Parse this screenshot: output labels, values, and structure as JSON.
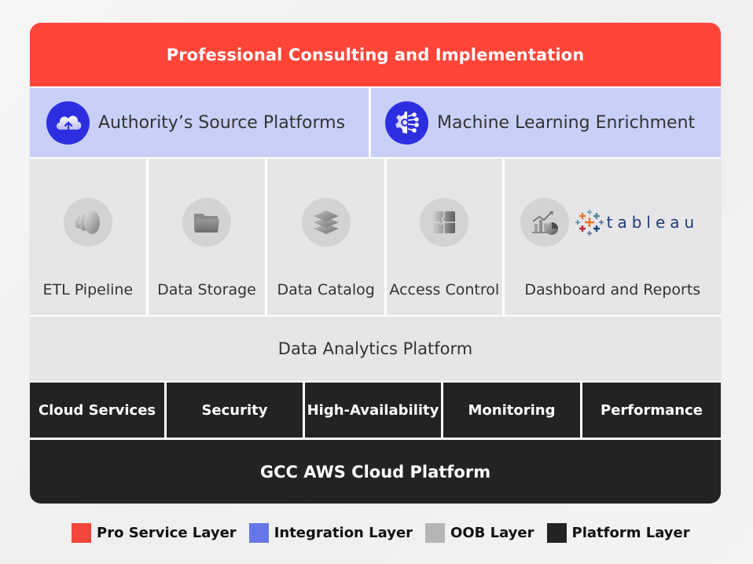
{
  "pro_service": {
    "title": "Professional Consulting and Implementation",
    "color": "#ff4438"
  },
  "integration": {
    "items": [
      {
        "label": "Authority’s Source Platforms",
        "icon": "cloud-upload-icon"
      },
      {
        "label": "Machine Learning Enrichment",
        "icon": "ai-gear-circuit-icon"
      }
    ],
    "color": "#c8d0f8",
    "icon_color": "#2c2ee0"
  },
  "oob": {
    "items": [
      {
        "label": "ETL Pipeline",
        "icon": "pipeline-icon"
      },
      {
        "label": "Data Storage",
        "icon": "folder-icon"
      },
      {
        "label": "Data Catalog",
        "icon": "layers-icon"
      },
      {
        "label": "Access Control",
        "icon": "puzzle-icon"
      },
      {
        "label": "Dashboard and Reports",
        "icon": "chart-icon",
        "brand": "tableau"
      }
    ],
    "color": "#e6e6e8"
  },
  "analytics": {
    "title": "Data Analytics Platform"
  },
  "platform": {
    "items": [
      {
        "label": "Cloud Services"
      },
      {
        "label": "Security"
      },
      {
        "label": "High-Availability"
      },
      {
        "label": "Monitoring"
      },
      {
        "label": "Performance"
      }
    ],
    "base_title": "GCC AWS Cloud Platform",
    "color": "#222325"
  },
  "legend": [
    {
      "label": "Pro Service Layer",
      "color": "#f2453b"
    },
    {
      "label": "Integration Layer",
      "color": "#6577e8"
    },
    {
      "label": "OOB Layer",
      "color": "#b5b5b5"
    },
    {
      "label": "Platform Layer",
      "color": "#222325"
    }
  ]
}
